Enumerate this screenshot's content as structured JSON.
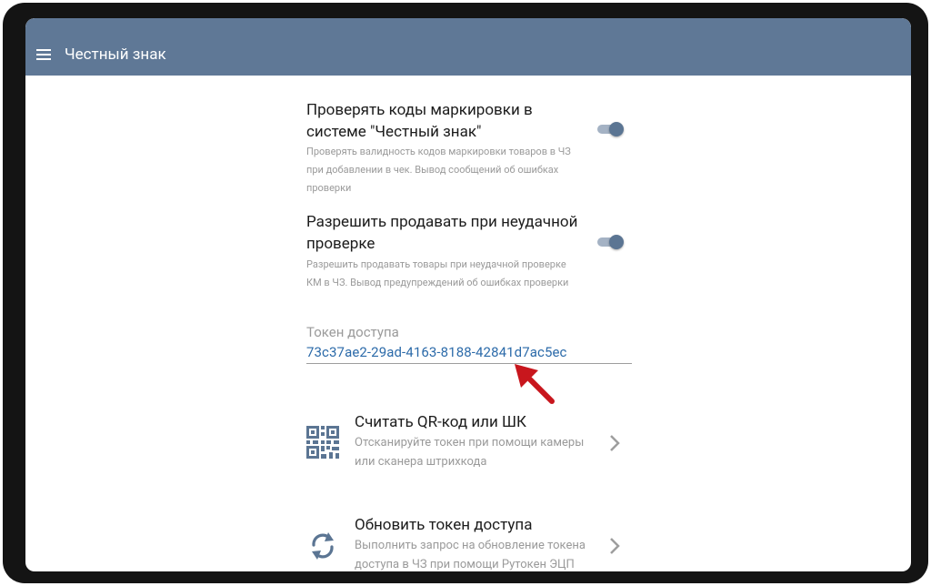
{
  "app": {
    "title": "Честный знак"
  },
  "settings": [
    {
      "title": "Проверять коды маркировки в системе \"Честный знак\"",
      "description": "Проверять валидность кодов маркировки товаров в ЧЗ при добавлении в чек. Вывод сообщений об ошибках проверки",
      "enabled": true
    },
    {
      "title": "Разрешить продавать при неудачной проверке",
      "description": "Разрешить продавать товары при неудачной проверке КМ в ЧЗ. Вывод предупреждений об ошибках проверки",
      "enabled": true
    }
  ],
  "token": {
    "label": "Токен доступа",
    "value": "73c37ae2-29ad-4163-8188-42841d7ac5ec"
  },
  "actions": [
    {
      "icon": "qr-code-icon",
      "title": "Считать QR-код или ШК",
      "description": "Отсканируйте токен при помощи камеры или сканера штрихкода"
    },
    {
      "icon": "refresh-icon",
      "title": "Обновить токен доступа",
      "description": "Выполнить запрос на обновление токена доступа в ЧЗ при помощи Рутокен ЭЦП"
    }
  ],
  "colors": {
    "appbar": "#5f7896",
    "switch_thumb": "#5b7593",
    "switch_track": "#a4b2c4",
    "token_text": "#2b6aa9",
    "annotation_arrow": "#c8161d"
  }
}
